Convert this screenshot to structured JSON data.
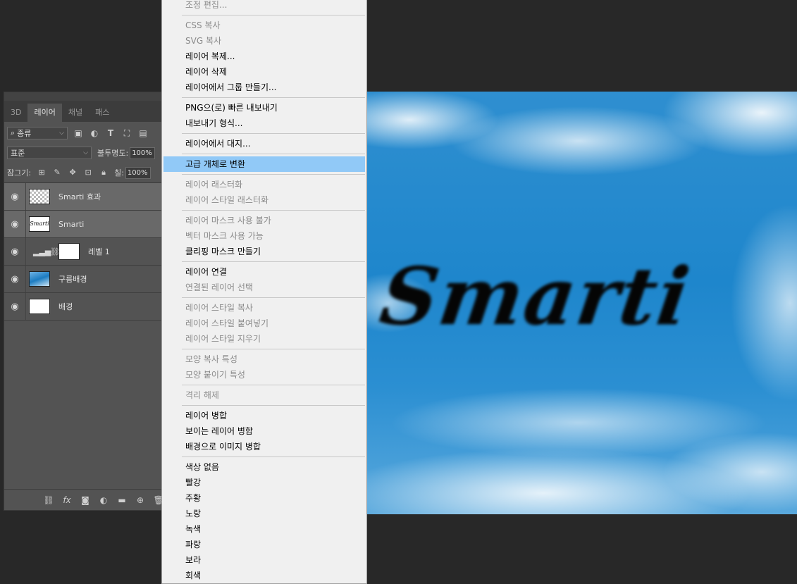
{
  "canvas": {
    "text": "Smarti"
  },
  "layers_panel": {
    "tabs": [
      {
        "label": "3D",
        "active": false
      },
      {
        "label": "레이어",
        "active": true
      },
      {
        "label": "채널",
        "active": false
      },
      {
        "label": "패스",
        "active": false
      }
    ],
    "filter_kind": "종류",
    "blend_mode": "표준",
    "opacity_label": "불투명도:",
    "opacity_value": "100%",
    "lock_label": "잠그기:",
    "fill_label": "칠:",
    "fill_value": "100%",
    "layers": [
      {
        "name": "Smarti 효과",
        "thumb": "checker",
        "selected": true
      },
      {
        "name": "Smarti",
        "thumb": "text",
        "thumb_text": "Smarti",
        "selected": true
      },
      {
        "name": "레벨 1",
        "thumb": "adjustment",
        "selected": false
      },
      {
        "name": "구름배경",
        "thumb": "sky",
        "selected": false
      },
      {
        "name": "배경",
        "thumb": "white",
        "selected": false,
        "locked": true
      }
    ]
  },
  "context_menu": {
    "items": [
      {
        "label": "조정 편집...",
        "disabled": true
      },
      {
        "sep": true
      },
      {
        "label": "CSS 복사",
        "disabled": true
      },
      {
        "label": "SVG 복사",
        "disabled": true
      },
      {
        "label": "레이어 복제...",
        "disabled": false
      },
      {
        "label": "레이어 삭제",
        "disabled": false
      },
      {
        "label": "레이어에서 그룹 만들기...",
        "disabled": false
      },
      {
        "sep": true
      },
      {
        "label": "PNG으(로) 빠른 내보내기",
        "disabled": false
      },
      {
        "label": "내보내기 형식...",
        "disabled": false
      },
      {
        "sep": true
      },
      {
        "label": "레이어에서 대지...",
        "disabled": false
      },
      {
        "sep": true
      },
      {
        "label": "고급 개체로 변환",
        "disabled": false,
        "highlight": true
      },
      {
        "sep": true
      },
      {
        "label": "레이어 래스터화",
        "disabled": true
      },
      {
        "label": "레이어 스타일 래스터화",
        "disabled": true
      },
      {
        "sep": true
      },
      {
        "label": "레이어 마스크 사용 불가",
        "disabled": true
      },
      {
        "label": "벡터 마스크 사용 가능",
        "disabled": true
      },
      {
        "label": "클리핑 마스크 만들기",
        "disabled": false
      },
      {
        "sep": true
      },
      {
        "label": "레이어 연결",
        "disabled": false
      },
      {
        "label": "연결된 레이어 선택",
        "disabled": true
      },
      {
        "sep": true
      },
      {
        "label": "레이어 스타일 복사",
        "disabled": true
      },
      {
        "label": "레이어 스타일 붙여넣기",
        "disabled": true
      },
      {
        "label": "레이어 스타일 지우기",
        "disabled": true
      },
      {
        "sep": true
      },
      {
        "label": "모양 복사 특성",
        "disabled": true
      },
      {
        "label": "모양 붙이기 특성",
        "disabled": true
      },
      {
        "sep": true
      },
      {
        "label": "격리 해제",
        "disabled": true
      },
      {
        "sep": true
      },
      {
        "label": "레이어 병합",
        "disabled": false
      },
      {
        "label": "보이는 레이어 병합",
        "disabled": false
      },
      {
        "label": "배경으로 이미지 병합",
        "disabled": false
      },
      {
        "sep": true
      },
      {
        "label": "색상 없음",
        "disabled": false
      },
      {
        "label": "빨강",
        "disabled": false
      },
      {
        "label": "주황",
        "disabled": false
      },
      {
        "label": "노랑",
        "disabled": false
      },
      {
        "label": "녹색",
        "disabled": false
      },
      {
        "label": "파랑",
        "disabled": false
      },
      {
        "label": "보라",
        "disabled": false
      },
      {
        "label": "회색",
        "disabled": false
      }
    ]
  }
}
